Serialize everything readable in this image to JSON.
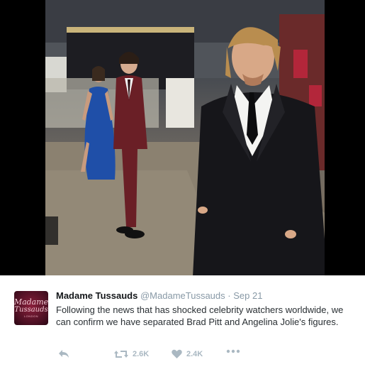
{
  "photo": {
    "alt_icon": "wax-figures-photo"
  },
  "tweet": {
    "avatar": {
      "line1": "Madame",
      "line2": "Tussauds",
      "line3": "LONDON"
    },
    "name": "Madame Tussauds",
    "handle": "@MadameTussauds",
    "separator": "·",
    "date": "Sep 21",
    "text": "Following the news that has shocked celebrity watchers worldwide, we can confirm we have separated Brad Pitt and Angelina Jolie's figures.",
    "actions": {
      "retweet_count": "2.6K",
      "like_count": "2.4K"
    }
  },
  "colors": {
    "name": "#14171a",
    "meta": "#8899a6",
    "text": "#292f33",
    "icons": "#aab8c2"
  }
}
